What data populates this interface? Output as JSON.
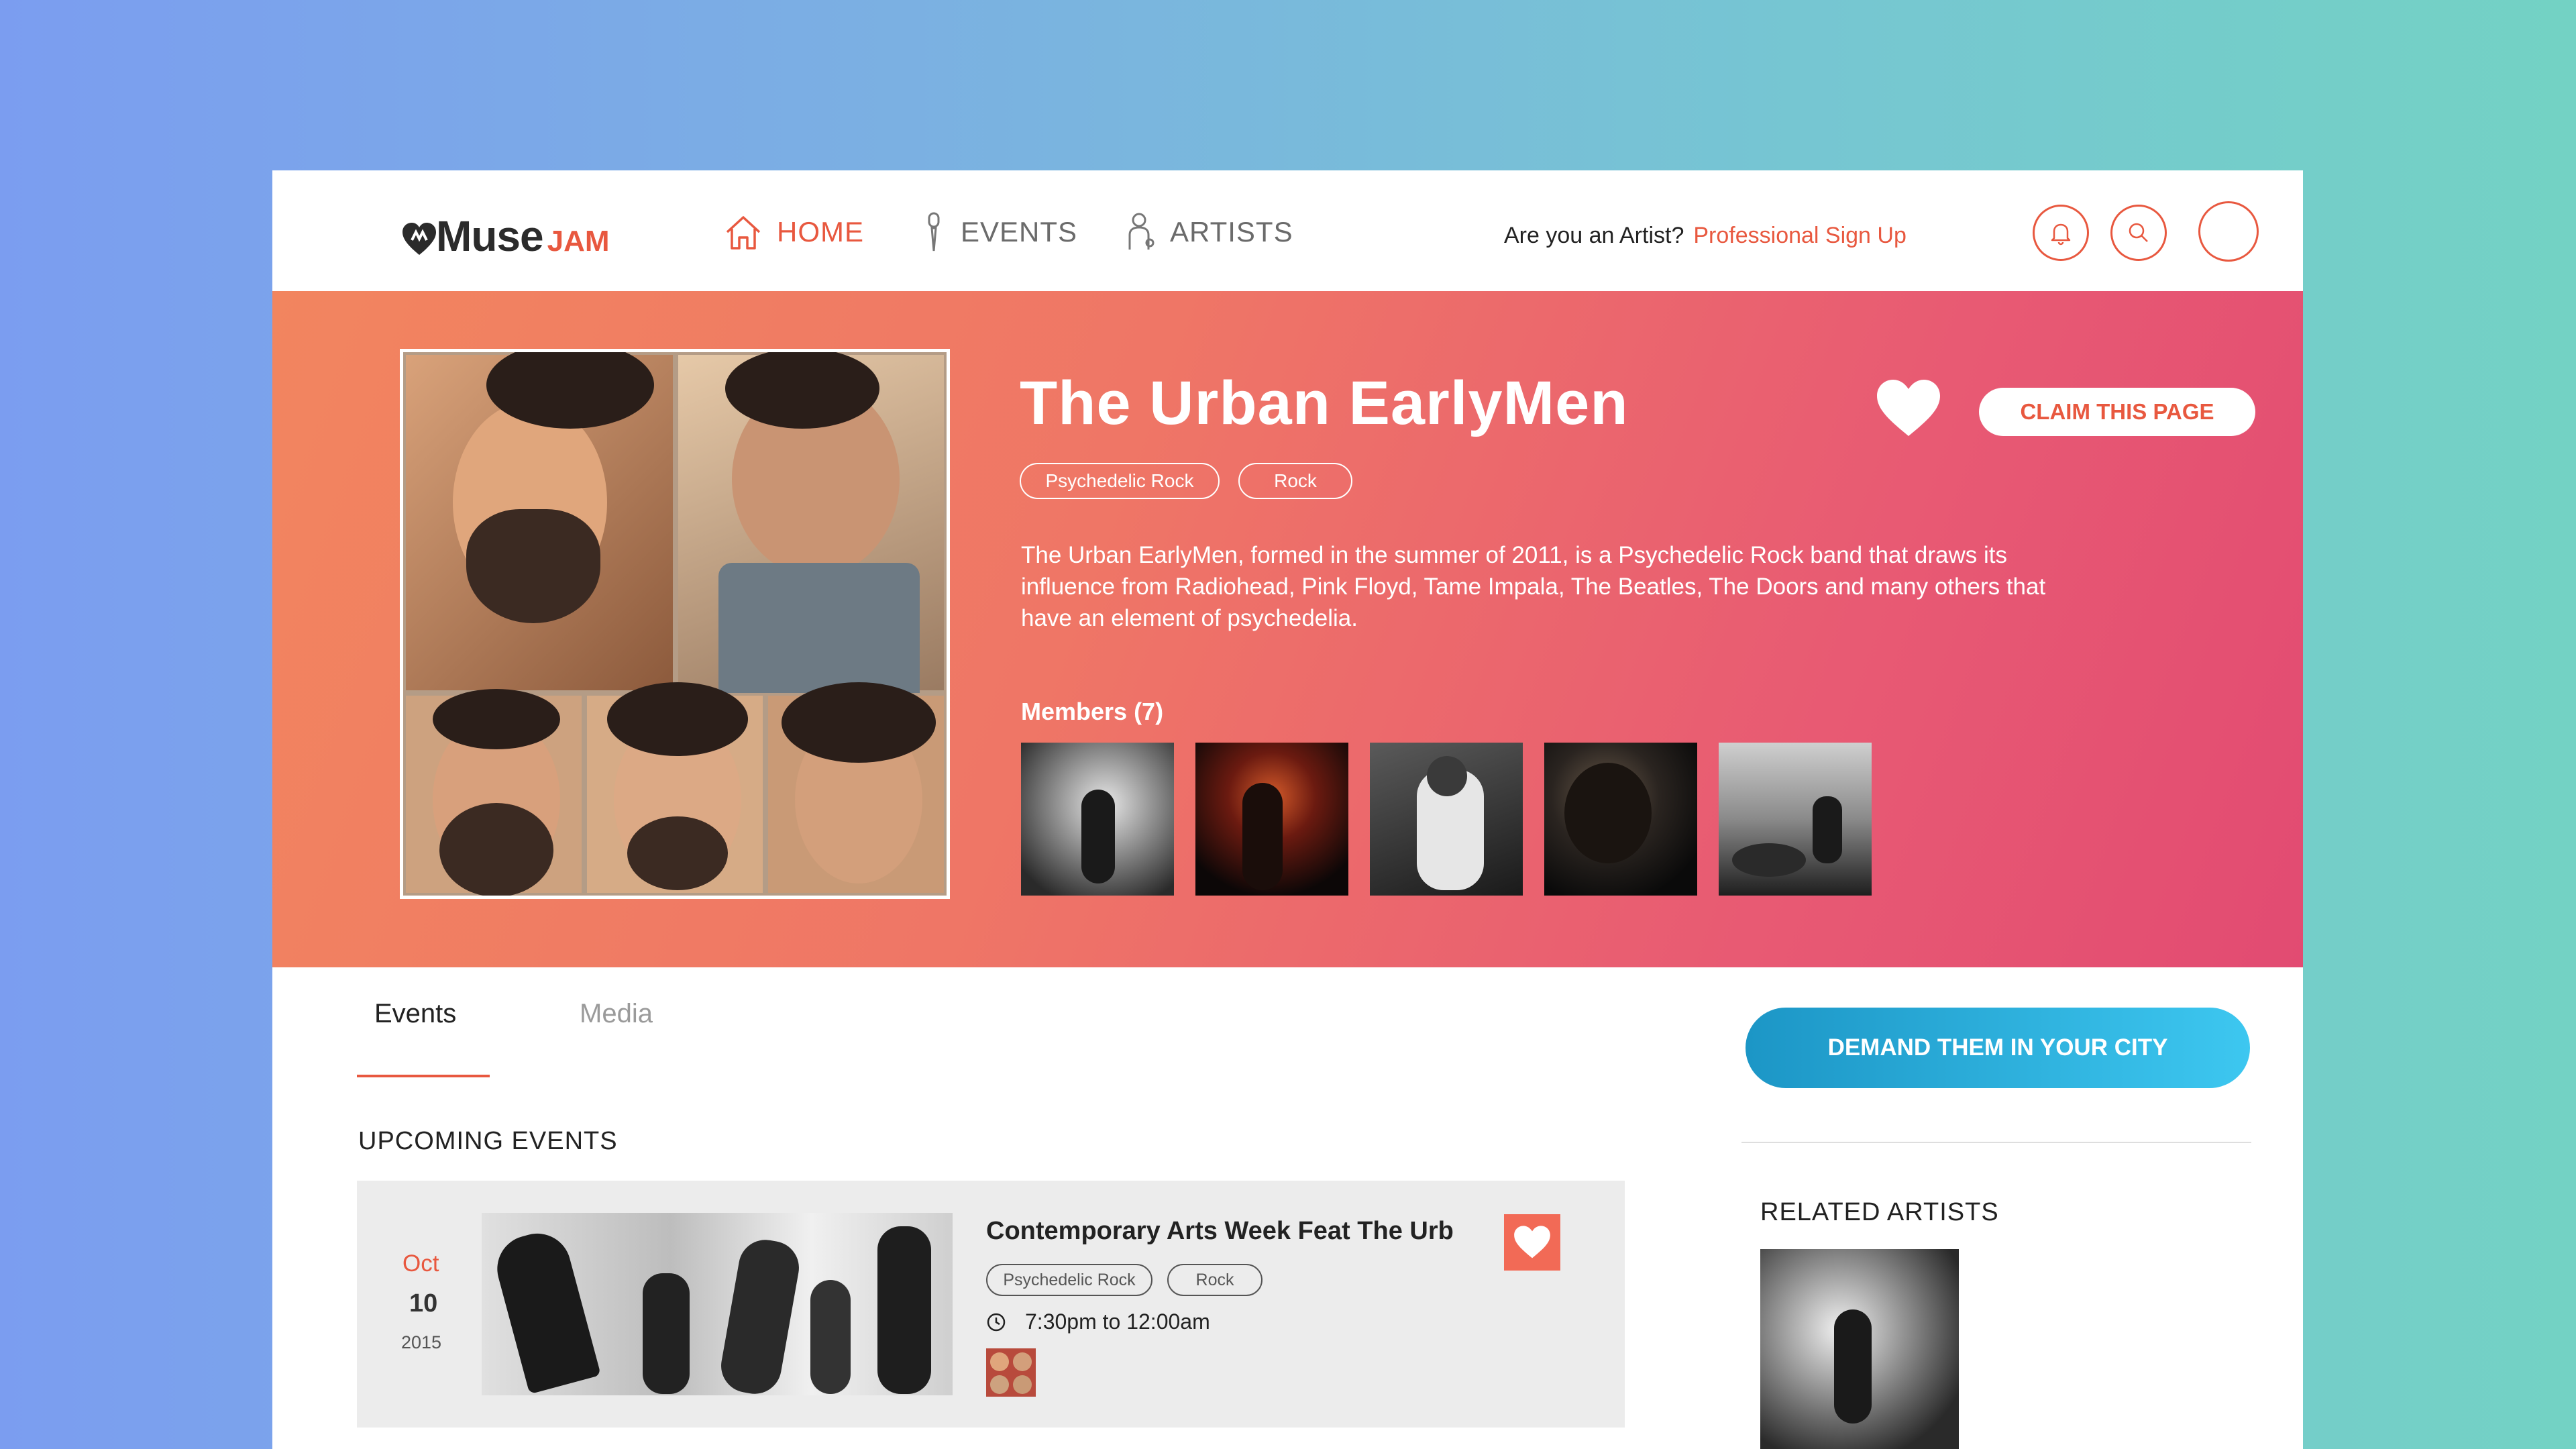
{
  "brand": {
    "muse": "Muse",
    "jam": "JAM"
  },
  "nav": {
    "items": [
      {
        "label": "HOME",
        "icon": "home-icon",
        "active": true
      },
      {
        "label": "EVENTS",
        "icon": "microphone-icon",
        "active": false
      },
      {
        "label": "ARTISTS",
        "icon": "artist-icon",
        "active": false
      }
    ],
    "artist_question": "Are you an Artist?",
    "pro_signup": "Professional Sign Up"
  },
  "artist": {
    "name": "The Urban EarlyMen",
    "tags": [
      "Psychedelic Rock",
      "Rock"
    ],
    "description": "The Urban EarlyMen, formed in the summer of 2011, is a Psychedelic Rock band that draws its influence from Radiohead, Pink Floyd, Tame Impala, The Beatles, The Doors and many others that have an element of psychedelia.",
    "members_label": "Members (7)",
    "claim_label": "CLAIM THIS PAGE"
  },
  "tabs": {
    "events": "Events",
    "media": "Media"
  },
  "demand_label": "DEMAND THEM IN YOUR CITY",
  "upcoming_label": "UPCOMING EVENTS",
  "related_label": "RELATED ARTISTS",
  "event": {
    "month": "Oct",
    "day": "10",
    "year": "2015",
    "title": "Contemporary Arts Week Feat The Urb",
    "tags": [
      "Psychedelic Rock",
      "Rock"
    ],
    "time": "7:30pm to 12:00am"
  },
  "colors": {
    "accent": "#e8583f",
    "hero_start": "#f2855f",
    "hero_end": "#e24b72",
    "demand_start": "#1c96c6",
    "demand_end": "#3dc7f0"
  }
}
